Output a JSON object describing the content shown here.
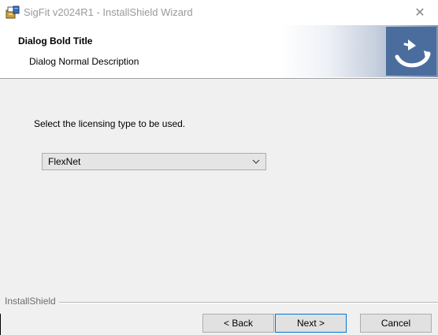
{
  "window": {
    "title": "SigFit v2024R1 - InstallShield Wizard",
    "close_glyph": "✕"
  },
  "banner": {
    "title": "Dialog Bold Title",
    "description": "Dialog Normal Description",
    "logo_icon": "installshield-logo-icon"
  },
  "content": {
    "prompt": "Select the licensing type to be used.",
    "licensing_select": {
      "selected": "FlexNet"
    }
  },
  "footer": {
    "brand": "InstallShield",
    "back_label": "< Back",
    "next_label": "Next >",
    "cancel_label": "Cancel"
  },
  "colors": {
    "banner_logo": "#4a6d9d",
    "default_button_border": "#0078d7"
  }
}
